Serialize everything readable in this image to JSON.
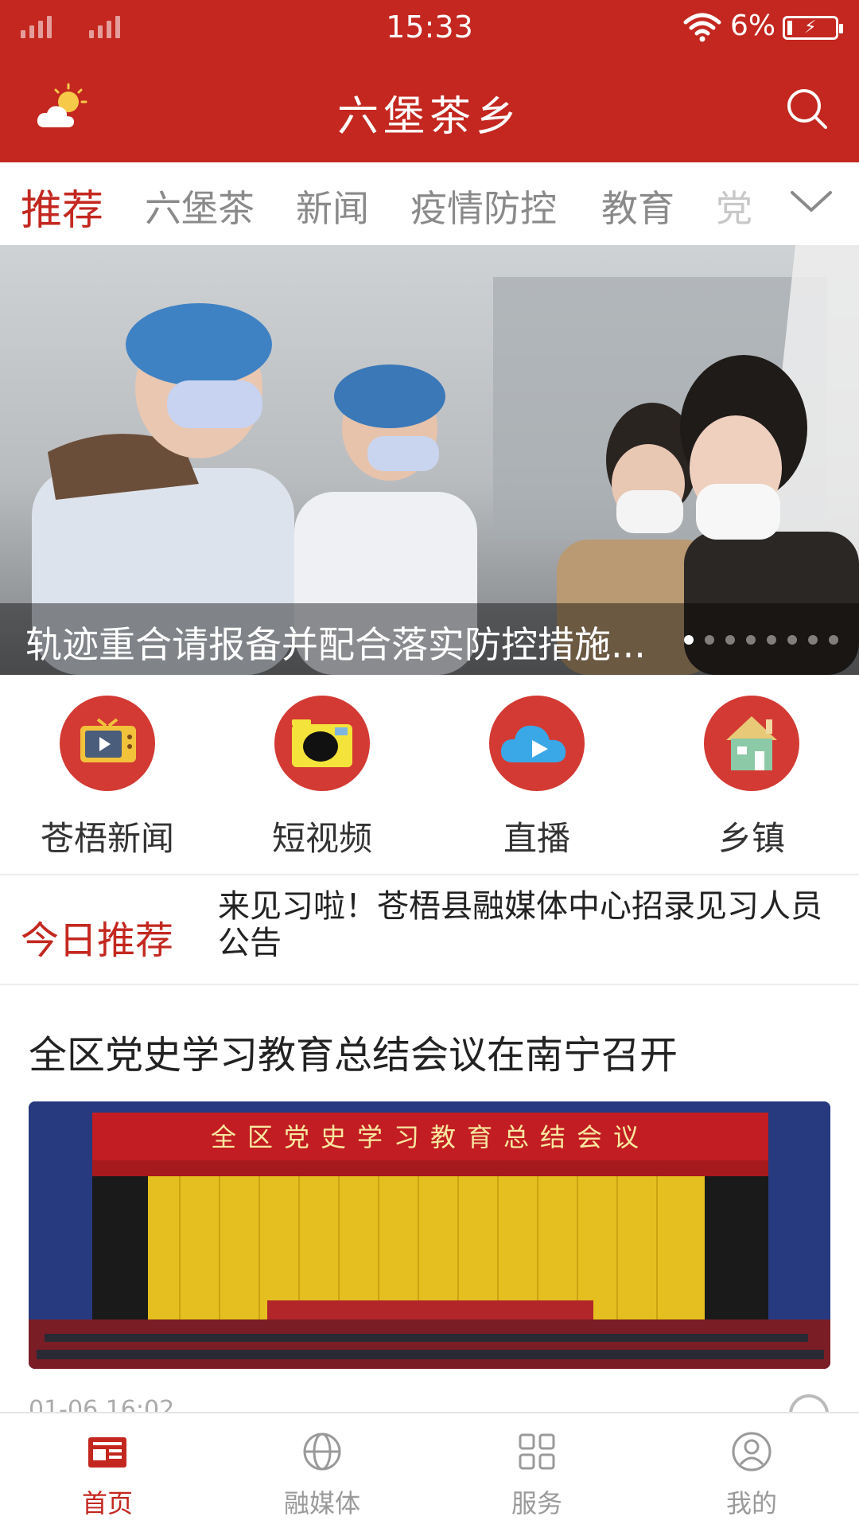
{
  "status_bar": {
    "time": "15:33",
    "battery": "6%"
  },
  "header": {
    "title": "六堡茶乡"
  },
  "tabs": [
    {
      "label": "推荐",
      "active": true
    },
    {
      "label": "六堡茶"
    },
    {
      "label": "新闻"
    },
    {
      "label": "疫情防控"
    },
    {
      "label": "教育"
    },
    {
      "label": "党"
    }
  ],
  "banner": {
    "caption": "轨迹重合请报备并配合落实防控措施...",
    "dots_total": 8,
    "active_dot": 1
  },
  "quick_entries": [
    {
      "label": "苍梧新闻",
      "icon": "tv-icon"
    },
    {
      "label": "短视频",
      "icon": "camera-icon"
    },
    {
      "label": "直播",
      "icon": "live-cloud-icon"
    },
    {
      "label": "乡镇",
      "icon": "house-icon"
    }
  ],
  "today": {
    "title": "今日推荐",
    "text": "来见习啦！苍梧县融媒体中心招录见习人员公告"
  },
  "article": {
    "title": "全区党史学习教育总结会议在南宁召开",
    "banner_text": "全区党史学习教育总结会议",
    "meta": "01-06 16:02"
  },
  "bottom_nav": [
    {
      "label": "首页",
      "icon": "news-icon",
      "active": true
    },
    {
      "label": "融媒体",
      "icon": "globe-icon"
    },
    {
      "label": "服务",
      "icon": "grid-icon"
    },
    {
      "label": "我的",
      "icon": "user-icon"
    }
  ],
  "colors": {
    "brand": "#c3271f",
    "icon_bg": "#d33a33"
  }
}
